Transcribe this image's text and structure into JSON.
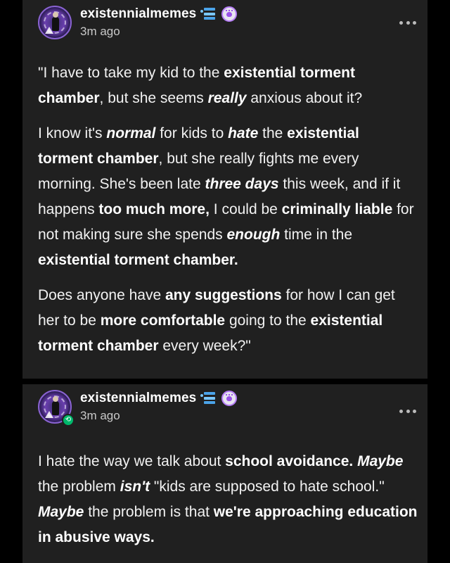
{
  "posts": [
    {
      "username": "existennialmemes",
      "time": "3m ago",
      "paragraphs": [
        [
          {
            "t": "\"I have to take my kid to the ",
            "s": "n"
          },
          {
            "t": "existential torment chamber",
            "s": "b"
          },
          {
            "t": ", but she seems ",
            "s": "n"
          },
          {
            "t": "really",
            "s": "i"
          },
          {
            "t": " anxious about it?",
            "s": "n"
          }
        ],
        [
          {
            "t": "I know it's ",
            "s": "n"
          },
          {
            "t": "normal",
            "s": "i"
          },
          {
            "t": " for kids to ",
            "s": "n"
          },
          {
            "t": "hate",
            "s": "i"
          },
          {
            "t": " the ",
            "s": "n"
          },
          {
            "t": "existential torment chamber",
            "s": "b"
          },
          {
            "t": ", but she really fights me every morning. She's been late ",
            "s": "n"
          },
          {
            "t": "three days",
            "s": "i"
          },
          {
            "t": " this week, and if it happens ",
            "s": "n"
          },
          {
            "t": "too much more,",
            "s": "b"
          },
          {
            "t": " I could be ",
            "s": "n"
          },
          {
            "t": "criminally liable",
            "s": "b"
          },
          {
            "t": " for not making sure she spends ",
            "s": "n"
          },
          {
            "t": "enough",
            "s": "i"
          },
          {
            "t": " time in the ",
            "s": "n"
          },
          {
            "t": "existential torment chamber.",
            "s": "b"
          }
        ],
        [
          {
            "t": "Does anyone have ",
            "s": "n"
          },
          {
            "t": "any suggestions",
            "s": "b"
          },
          {
            "t": " for how I can get her to be ",
            "s": "n"
          },
          {
            "t": "more comfortable",
            "s": "b"
          },
          {
            "t": " going to the ",
            "s": "n"
          },
          {
            "t": "existential torment chamber",
            "s": "b"
          },
          {
            "t": " every week?\"",
            "s": "n"
          }
        ]
      ]
    },
    {
      "username": "existennialmemes",
      "time": "3m ago",
      "paragraphs": [
        [
          {
            "t": "I hate the way we talk about ",
            "s": "n"
          },
          {
            "t": "school avoidance.",
            "s": "b"
          },
          {
            "t": " ",
            "s": "n"
          },
          {
            "t": "Maybe",
            "s": "i"
          },
          {
            "t": " the problem ",
            "s": "n"
          },
          {
            "t": "isn't",
            "s": "i"
          },
          {
            "t": " \"kids are supposed to hate school.\" ",
            "s": "n"
          },
          {
            "t": "Maybe",
            "s": "i"
          },
          {
            "t": " the problem is that ",
            "s": "n"
          },
          {
            "t": "we're approaching education in abusive ways.",
            "s": "b"
          }
        ]
      ]
    }
  ],
  "icons": {
    "more": "more-options-icon",
    "avatar": "avatar",
    "reblog": "reblog-icon"
  },
  "colors": {
    "card_bg": "#202020",
    "page_bg": "#000000",
    "reblog_green": "#00b86b"
  }
}
